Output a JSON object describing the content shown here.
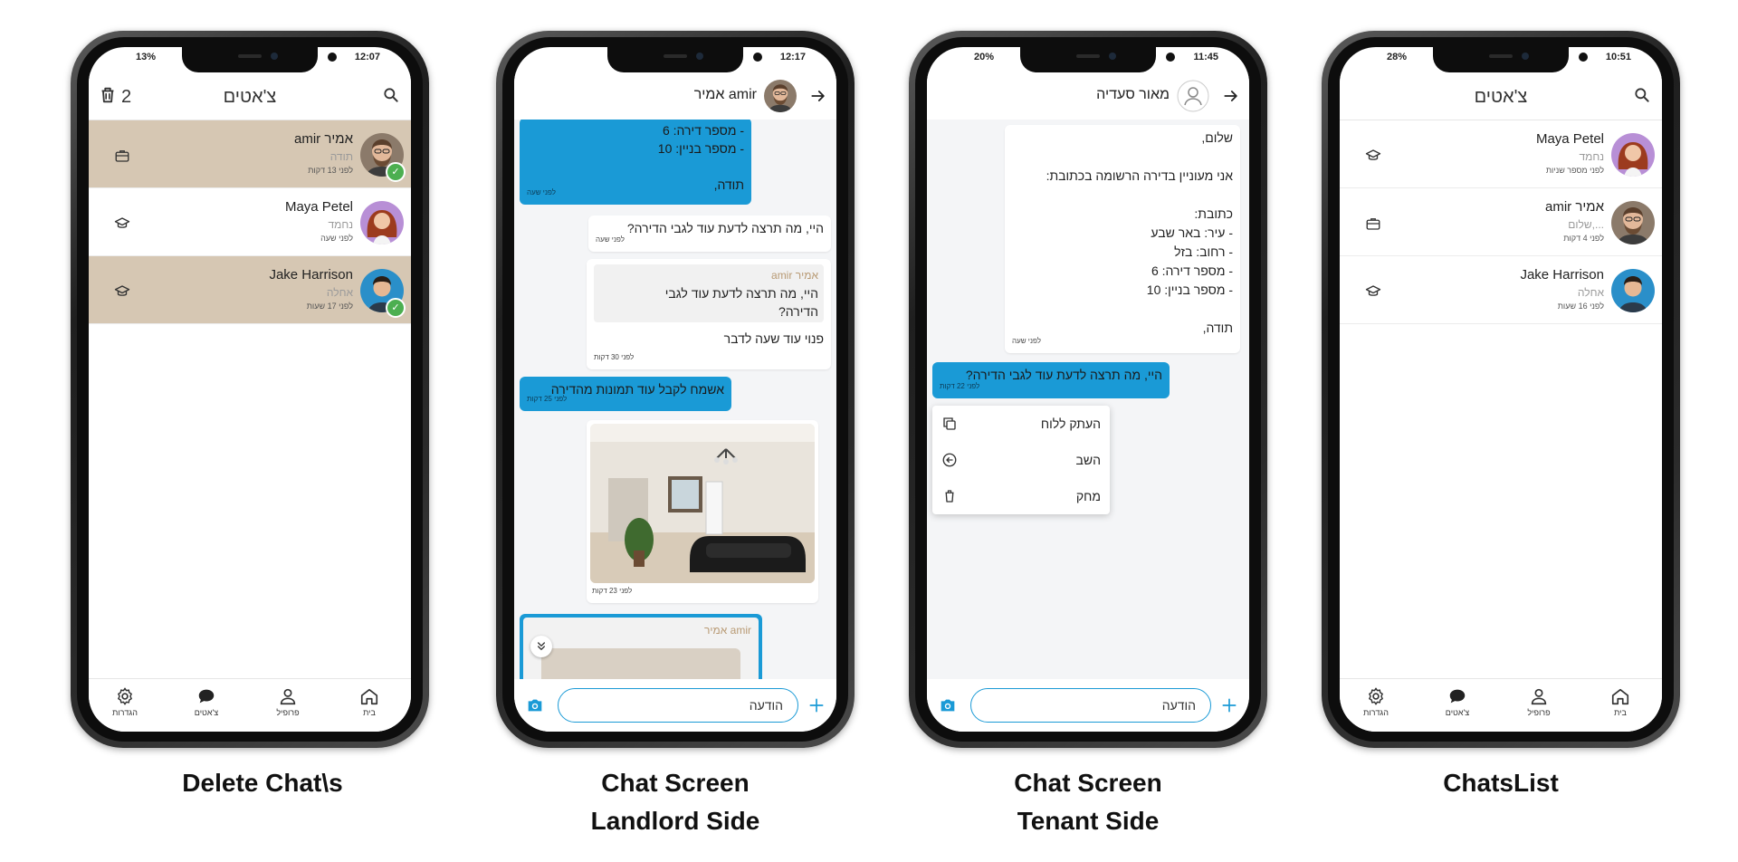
{
  "colors": {
    "accent_blue": "#1a9ad6",
    "selected_row": "#d6c7b3",
    "check_green": "#4caf50",
    "sender_name": "#b89a74"
  },
  "nav": {
    "settings": "הגדרות",
    "chats": "צ'אטים",
    "profile": "פרופיל",
    "home": "בית"
  },
  "phone1": {
    "status_battery": "13%",
    "status_time": "12:07",
    "title": "צ'אטים",
    "delete_count": "2",
    "rows": [
      {
        "name": "amir אמיר",
        "preview": "תודה",
        "time": "לפני 13 דקות",
        "icon": "briefcase-icon",
        "selected": true,
        "checked": true
      },
      {
        "name": "Maya Petel",
        "preview": "נחמד",
        "time": "לפני שעה",
        "icon": "graduation-cap-icon",
        "selected": false,
        "checked": false
      },
      {
        "name": "Jake Harrison",
        "preview": "אחלה",
        "time": "לפני 17 שעות",
        "icon": "graduation-cap-icon",
        "selected": true,
        "checked": true
      }
    ]
  },
  "phone2": {
    "status_time": "12:17",
    "header_name": "amir אמיר",
    "msg1": {
      "lines": [
        "- מספר דירה: 6",
        "- מספר בניין: 10",
        "",
        "תודה,"
      ],
      "time": "לפני שעה"
    },
    "msg2": {
      "text": "היי, מה תרצה לדעת עוד לגבי הדירה?",
      "time": "לפני שעה"
    },
    "msg3": {
      "sender": "אמיר amir",
      "quote_line1": "היי, מה תרצה לדעת עוד לגבי",
      "quote_line2": "הדירה?",
      "text": "פנוי עוד שעה לדבר",
      "time": "לפני 30 דקות"
    },
    "msg4": {
      "text": "אשמח לקבל עוד תמונות מהדירה",
      "time": "לפני 25 דקות"
    },
    "msg5": {
      "time": "לפני 23 דקות"
    },
    "msg6": {
      "sender": "amir אמיר"
    },
    "input_placeholder": "הודעה"
  },
  "phone3": {
    "status_battery": "20%",
    "status_time": "11:45",
    "header_name": "מאור סעדיה",
    "msg1": {
      "lines": [
        "שלום,",
        "",
        "אני מעוניין בדירה הרשומה בכתובת:",
        "",
        "כתובת:",
        "- עיר: באר שבע",
        "- רחוב: בזל",
        "- מספר דירה: 6",
        "- מספר בניין: 10",
        "",
        "תודה,"
      ],
      "time": "לפני שעה"
    },
    "msg2": {
      "text": "היי, מה תרצה לדעת עוד לגבי הדירה?",
      "time": "לפני 22 דקות"
    },
    "menu": {
      "copy": "העתק ללוח",
      "reply": "השב",
      "delete": "מחק"
    },
    "input_placeholder": "הודעה"
  },
  "phone4": {
    "status_battery": "28%",
    "status_time": "10:51",
    "title": "צ'אטים",
    "rows": [
      {
        "name": "Maya Petel",
        "preview": "נחמד",
        "time": "לפני מספר שניות",
        "icon": "graduation-cap-icon"
      },
      {
        "name": "amir אמיר",
        "preview": "שלום,...",
        "time": "לפני 4 דקות",
        "icon": "briefcase-icon"
      },
      {
        "name": "Jake Harrison",
        "preview": "אחלה",
        "time": "לפני 16 שעות",
        "icon": "graduation-cap-icon"
      }
    ]
  },
  "captions": {
    "phone1": "Delete Chat\\s",
    "phone2_line1": "Chat Screen",
    "phone2_line2": "Landlord Side",
    "phone3_line1": "Chat Screen",
    "phone3_line2": "Tenant Side",
    "phone4": "ChatsList"
  }
}
